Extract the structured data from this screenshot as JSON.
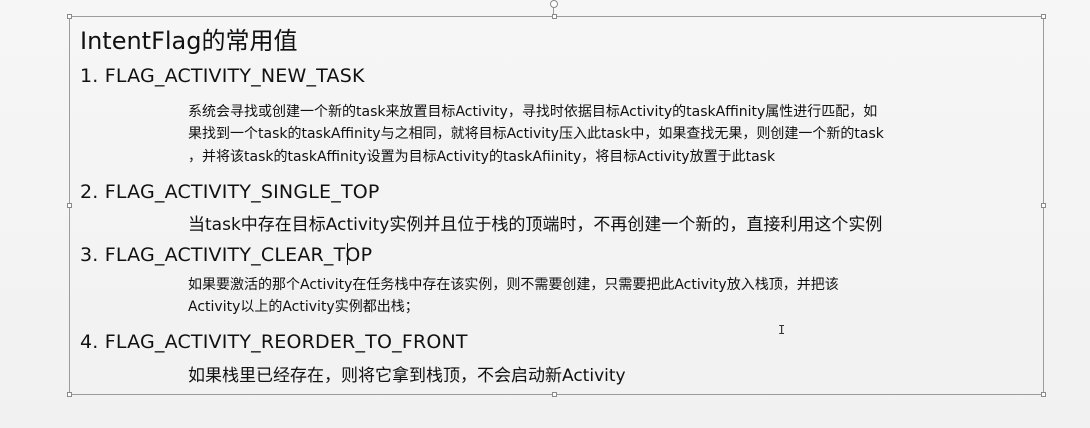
{
  "title": "IntentFlag的常用值",
  "items": [
    {
      "heading": "1. FLAG_ACTIVITY_NEW_TASK",
      "lines": [
        "系统会寻找或创建一个新的task来放置目标Activity，寻找时依据目标Activity的taskAffinity属性进行匹配，如",
        "果找到一个task的taskAffinity与之相同，就将目标Activity压入此task中，如果查找无果，则创建一个新的task",
        "，并将该task的taskAffinity设置为目标Activity的taskAfiinity，将目标Activity放置于此task"
      ]
    },
    {
      "heading": "2. FLAG_ACTIVITY_SINGLE_TOP",
      "lines": [
        "当task中存在目标Activity实例并且位于栈的顶端时，不再创建一个新的，直接利用这个实例"
      ]
    },
    {
      "heading": "3. FLAG_ACTIVITY_CLEAR_TOP",
      "lines": [
        "如果要激活的那个Activity在任务栈中存在该实例，则不需要创建，只需要把此Activity放入栈顶，并把该",
        "Activity以上的Activity实例都出栈；"
      ]
    },
    {
      "heading": "4. FLAG_ACTIVITY_REORDER_TO_FRONT",
      "lines": [
        "如果栈里已经存在，则将它拿到栈顶，不会启动新Activity"
      ]
    }
  ]
}
